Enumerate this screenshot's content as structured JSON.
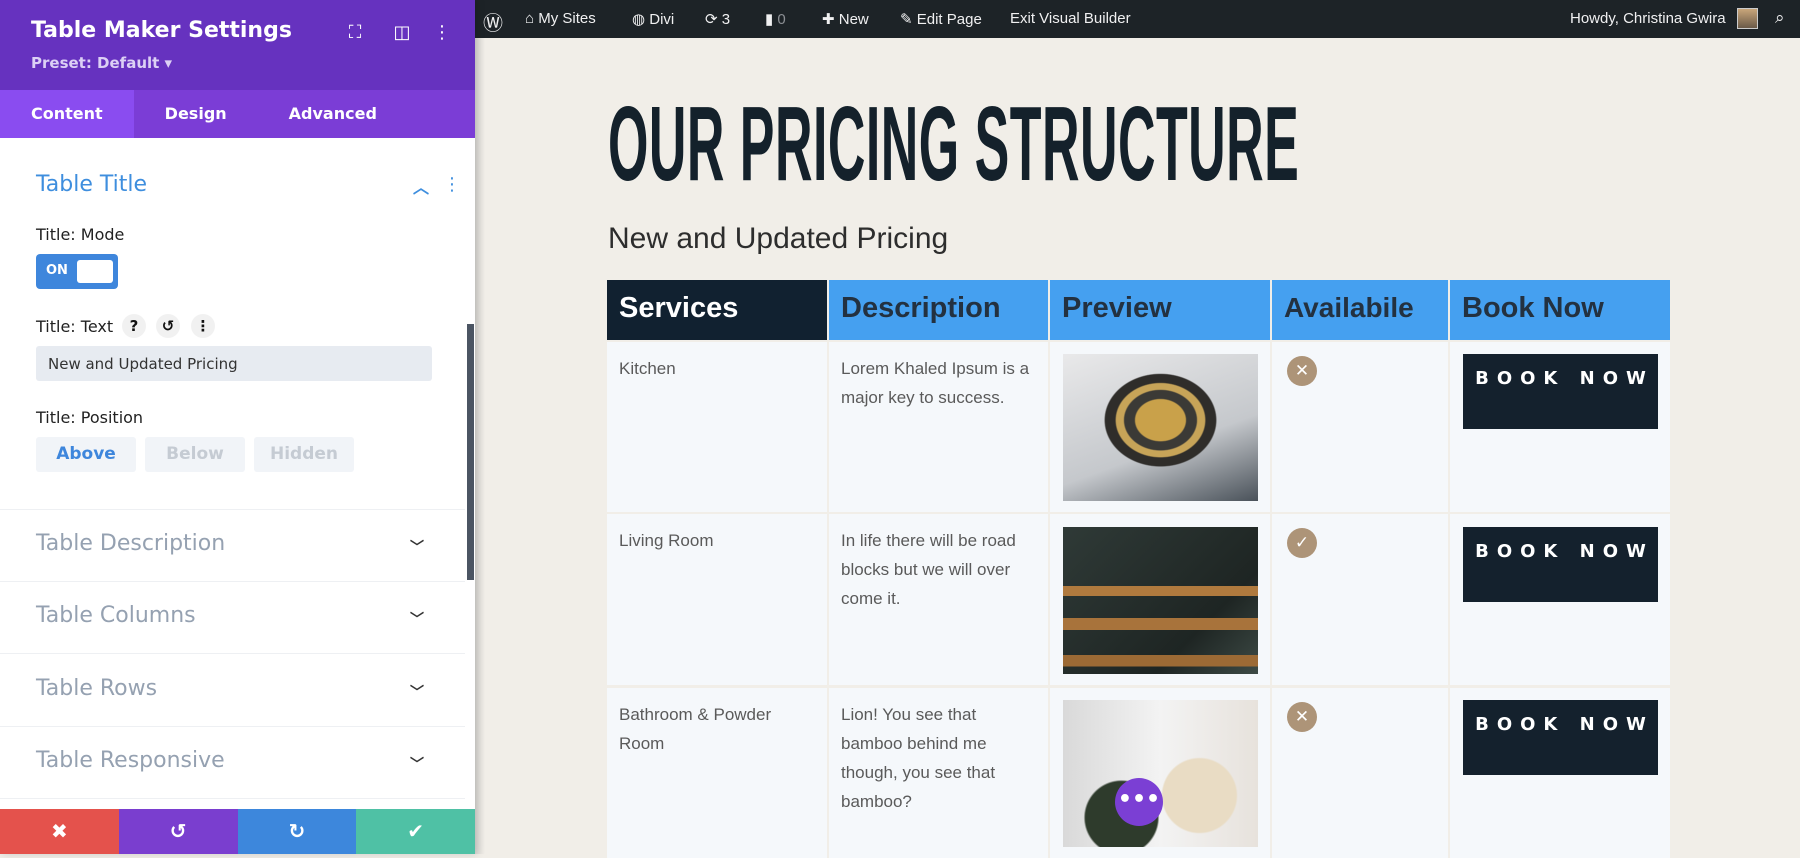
{
  "sidebar": {
    "title": "Table Maker Settings",
    "preset": "Preset: Default ▾",
    "tabs": [
      "Content",
      "Design",
      "Advanced"
    ],
    "section_title": "Table Title",
    "mode_label": "Title: Mode",
    "toggle_label": "ON",
    "text_label": "Title: Text",
    "title_text_value": "New and Updated Pricing",
    "position_label": "Title: Position",
    "positions": [
      "Above",
      "Below",
      "Hidden"
    ],
    "accordions": [
      "Table Description",
      "Table Columns",
      "Table Rows",
      "Table Responsive"
    ]
  },
  "adminbar": {
    "my_sites": "My Sites",
    "divi": "Divi",
    "updates": "3",
    "comments": "0",
    "new": "New",
    "edit_page": "Edit Page",
    "exit": "Exit Visual Builder",
    "howdy": "Howdy, Christina Gwira"
  },
  "page": {
    "heading": "OUR PRICING STRUCTURE",
    "subtitle": "New and Updated Pricing",
    "columns": [
      "Services",
      "Description",
      "Preview",
      "Availabile",
      "Book Now"
    ],
    "rows": [
      {
        "service": "Kitchen",
        "description": "Lorem Khaled Ipsum is a major key to success.",
        "available": false,
        "button": "BOOK NOW"
      },
      {
        "service": "Living Room",
        "description": "In life there will be road blocks but we will over come it.",
        "available": true,
        "button": "BOOK NOW"
      },
      {
        "service": "Bathroom & Powder Room",
        "description": "Lion! You see that bamboo behind me though, you see that bamboo?",
        "available": false,
        "button": "BOOK NOW"
      }
    ]
  },
  "colors": {
    "purple": "#6632bf",
    "blue": "#45a0f0",
    "dark": "#112130",
    "tan": "#ad9478"
  }
}
